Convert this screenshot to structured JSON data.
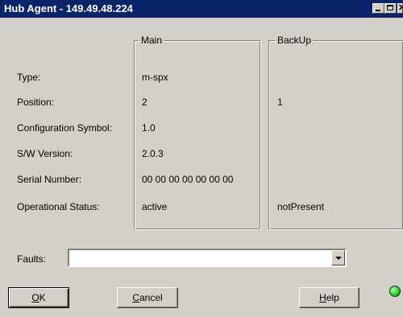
{
  "window": {
    "title": "Hub Agent - 149.49.48.224",
    "controls": [
      "minimize-icon",
      "maximize-icon",
      "close-icon"
    ]
  },
  "groups": {
    "main_label": "Main",
    "backup_label": "BackUp"
  },
  "fields": [
    {
      "label": "Type:",
      "main": "m-spx",
      "backup": ""
    },
    {
      "label": "Position:",
      "main": "2",
      "backup": "1"
    },
    {
      "label": "Configuration Symbol:",
      "main": "1.0",
      "backup": ""
    },
    {
      "label": "S/W Version:",
      "main": "2.0.3",
      "backup": ""
    },
    {
      "label": "Serial Number:",
      "main": "00 00 00 00 00 00 00",
      "backup": ""
    },
    {
      "label": "Operational Status:",
      "main": "active",
      "backup": "notPresent"
    }
  ],
  "faults": {
    "label": "Faults:",
    "value": ""
  },
  "buttons": {
    "ok_mnemonic": "O",
    "ok_rest": "K",
    "cancel_mnemonic": "C",
    "cancel_rest": "ancel",
    "help_mnemonic": "H",
    "help_rest": "elp"
  },
  "status_led": {
    "color": "#20d020"
  }
}
